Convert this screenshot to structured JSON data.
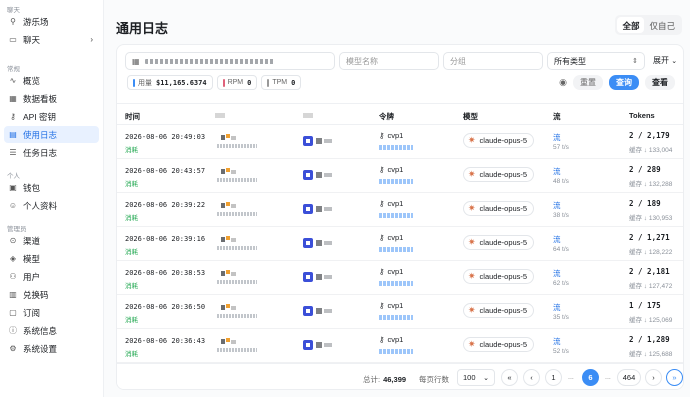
{
  "sidebar": {
    "sections": [
      {
        "title": "聊天",
        "items": [
          {
            "label": "游乐场",
            "icon": "playground-icon"
          },
          {
            "label": "聊天",
            "icon": "chat-icon",
            "chevron": true
          }
        ]
      },
      {
        "title": "常规",
        "items": [
          {
            "label": "概览",
            "icon": "pulse-icon"
          },
          {
            "label": "数据看板",
            "icon": "dashboard-icon"
          },
          {
            "label": "API 密钥",
            "icon": "key-icon"
          },
          {
            "label": "使用日志",
            "icon": "document-icon",
            "active": true
          },
          {
            "label": "任务日志",
            "icon": "task-icon"
          }
        ]
      },
      {
        "title": "个人",
        "items": [
          {
            "label": "钱包",
            "icon": "wallet-icon"
          },
          {
            "label": "个人资料",
            "icon": "user-icon"
          }
        ]
      },
      {
        "title": "管理员",
        "items": [
          {
            "label": "渠道",
            "icon": "channel-icon"
          },
          {
            "label": "模型",
            "icon": "cube-icon"
          },
          {
            "label": "用户",
            "icon": "users-icon"
          },
          {
            "label": "兑换码",
            "icon": "ticket-icon"
          },
          {
            "label": "订阅",
            "icon": "subscribe-icon"
          },
          {
            "label": "系统信息",
            "icon": "info-icon"
          },
          {
            "label": "系统设置",
            "icon": "settings-icon"
          }
        ]
      }
    ]
  },
  "header": {
    "title": "通用日志",
    "scope": [
      "全部",
      "仅自己"
    ],
    "scope_active": 0
  },
  "filters": {
    "model_placeholder": "模型名称",
    "group_placeholder": "分组",
    "type_value": "所有类型",
    "expand_label": "展开"
  },
  "stats": [
    {
      "label": "用量",
      "value": "$11,165.6374",
      "color": "#3b8df5"
    },
    {
      "label": "RPM",
      "value": "0",
      "color": "#e0627b"
    },
    {
      "label": "TPM",
      "value": "0",
      "color": "#999999"
    }
  ],
  "actions": {
    "reset": "重置",
    "query": "查询",
    "view": "查看"
  },
  "table": {
    "headers": [
      "时间",
      "令牌",
      "模型",
      "流",
      "Tokens"
    ],
    "rows": [
      {
        "time": "2026-08-06 20:49:03",
        "type": "消耗",
        "token": "cvp1",
        "model": "claude-opus-5",
        "stream": "流",
        "speed": "57 t/s",
        "tokens": "2 / 2,179",
        "cache": "缓存 ↓ 133,004"
      },
      {
        "time": "2026-08-06 20:43:57",
        "type": "消耗",
        "token": "cvp1",
        "model": "claude-opus-5",
        "stream": "流",
        "speed": "48 t/s",
        "tokens": "2 / 289",
        "cache": "缓存 ↓ 132,288"
      },
      {
        "time": "2026-08-06 20:39:22",
        "type": "消耗",
        "token": "cvp1",
        "model": "claude-opus-5",
        "stream": "流",
        "speed": "38 t/s",
        "tokens": "2 / 189",
        "cache": "缓存 ↓ 130,953"
      },
      {
        "time": "2026-08-06 20:39:16",
        "type": "消耗",
        "token": "cvp1",
        "model": "claude-opus-5",
        "stream": "流",
        "speed": "64 t/s",
        "tokens": "2 / 1,271",
        "cache": "缓存 ↓ 128,222"
      },
      {
        "time": "2026-08-06 20:38:53",
        "type": "消耗",
        "token": "cvp1",
        "model": "claude-opus-5",
        "stream": "流",
        "speed": "62 t/s",
        "tokens": "2 / 2,181",
        "cache": "缓存 ↓ 127,472"
      },
      {
        "time": "2026-08-06 20:36:50",
        "type": "消耗",
        "token": "cvp1",
        "model": "claude-opus-5",
        "stream": "流",
        "speed": "35 t/s",
        "tokens": "1 / 175",
        "cache": "缓存 ↓ 125,069"
      },
      {
        "time": "2026-08-06 20:36:43",
        "type": "消耗",
        "token": "cvp1",
        "model": "claude-opus-5",
        "stream": "流",
        "speed": "52 t/s",
        "tokens": "2 / 1,289",
        "cache": "缓存 ↓ 125,688"
      }
    ]
  },
  "pagination": {
    "total_label": "总计:",
    "total": "46,399",
    "per_page_label": "每页行数",
    "per_page": "100",
    "pages": [
      "1",
      "...",
      "6",
      "...",
      "464"
    ],
    "current": "6"
  },
  "colors": {
    "accent": "#3b8df5",
    "active_bg": "#e8f1ff",
    "consume": "#1aa54b",
    "model_star": "#d8734a"
  }
}
